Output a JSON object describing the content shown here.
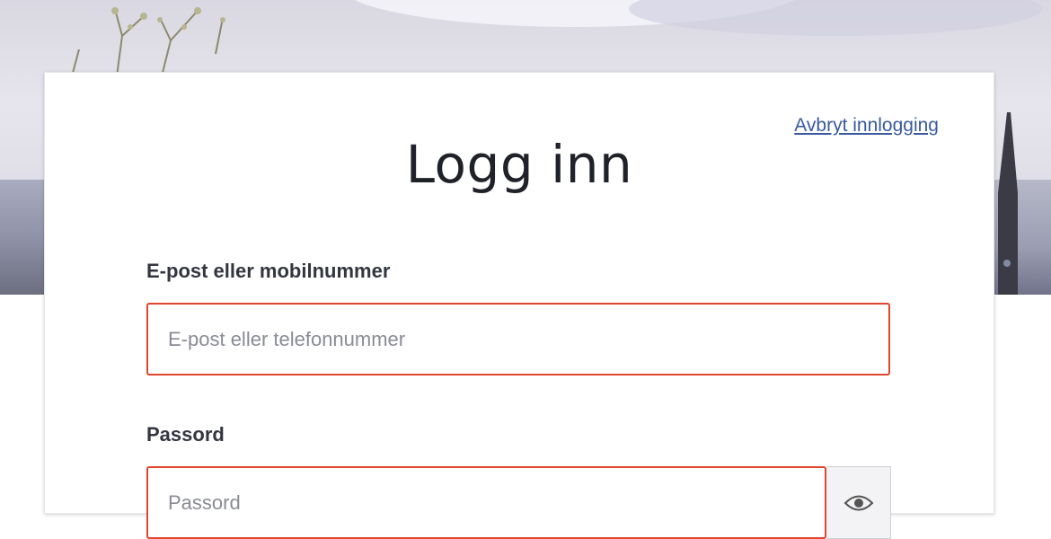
{
  "login": {
    "title": "Logg inn",
    "cancel_link": "Avbryt innlogging",
    "email_label": "E-post eller mobilnummer",
    "email_placeholder": "E-post eller telefonnummer",
    "email_value": "",
    "password_label": "Passord",
    "password_placeholder": "Passord",
    "password_value": "",
    "show_password_icon": "eye-icon"
  },
  "colors": {
    "error_border": "#e0452e",
    "link": "#3a5a9e",
    "title_text": "#1f2228"
  }
}
